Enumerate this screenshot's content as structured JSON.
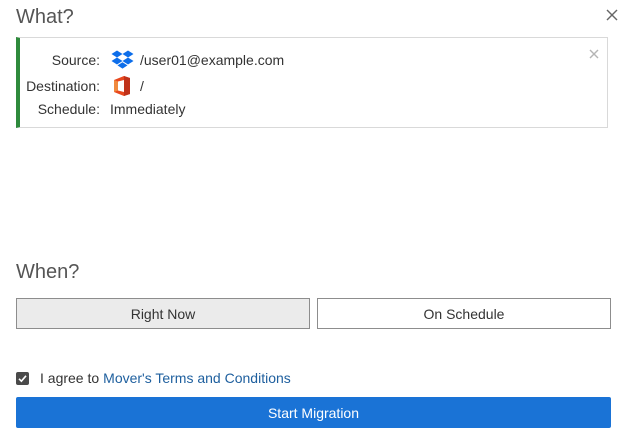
{
  "what": {
    "heading": "What?",
    "accent_color": "#2e8a3c",
    "rows": {
      "source": {
        "label": "Source:",
        "icon": "dropbox-icon",
        "value": "/user01@example.com"
      },
      "destination": {
        "label": "Destination:",
        "icon": "office-365-icon",
        "value": "/"
      },
      "schedule": {
        "label": "Schedule:",
        "value": "Immediately"
      }
    }
  },
  "when": {
    "heading": "When?",
    "buttons": {
      "right_now": "Right Now",
      "on_schedule": "On Schedule"
    },
    "selected": "Right Now"
  },
  "agreement": {
    "checked": true,
    "text": "I agree to",
    "link_text": "Mover's Terms and Conditions"
  },
  "actions": {
    "start_label": "Start Migration",
    "start_color": "#1a73d6"
  }
}
